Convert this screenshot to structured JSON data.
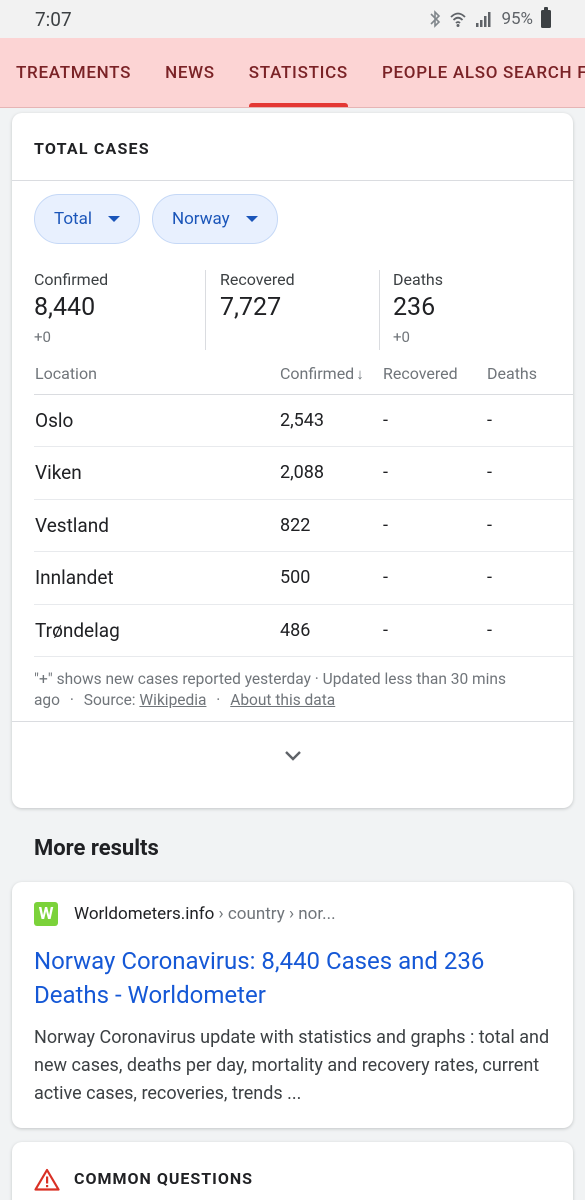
{
  "status": {
    "time": "7:07",
    "battery": "95%"
  },
  "tabs": [
    {
      "label": "TREATMENTS"
    },
    {
      "label": "NEWS"
    },
    {
      "label": "STATISTICS"
    },
    {
      "label": "PEOPLE ALSO SEARCH FOR"
    }
  ],
  "stats": {
    "title": "TOTAL CASES",
    "filter_scope": "Total",
    "filter_region": "Norway",
    "summary": {
      "confirmed_label": "Confirmed",
      "confirmed_value": "8,440",
      "confirmed_delta": "+0",
      "recovered_label": "Recovered",
      "recovered_value": "7,727",
      "deaths_label": "Deaths",
      "deaths_value": "236",
      "deaths_delta": "+0"
    },
    "table": {
      "headers": {
        "location": "Location",
        "confirmed": "Confirmed",
        "sort_arrow": "↓",
        "recovered": "Recovered",
        "deaths": "Deaths"
      },
      "rows": [
        {
          "location": "Oslo",
          "confirmed": "2,543",
          "recovered": "-",
          "deaths": "-"
        },
        {
          "location": "Viken",
          "confirmed": "2,088",
          "recovered": "-",
          "deaths": "-"
        },
        {
          "location": "Vestland",
          "confirmed": "822",
          "recovered": "-",
          "deaths": "-"
        },
        {
          "location": "Innlandet",
          "confirmed": "500",
          "recovered": "-",
          "deaths": "-"
        },
        {
          "location": "Trøndelag",
          "confirmed": "486",
          "recovered": "-",
          "deaths": "-"
        }
      ]
    },
    "footnote_text": "\"+\" shows new cases reported yesterday · Updated less than 30 mins ago",
    "source_label": "Source:",
    "source_link": "Wikipedia",
    "about_link": "About this data",
    "separator": "·"
  },
  "more_results_heading": "More results",
  "result": {
    "favicon_letter": "W",
    "site_name": "Worldometers.info",
    "site_path": " › country › nor...",
    "title": "Norway Coronavirus: 8,440 Cases and 236 Deaths - Worldometer",
    "snippet": "Norway Coronavirus update with statistics and graphs : total and new cases, deaths per day, mortality and recovery rates, current active cases, recoveries, trends ..."
  },
  "common_questions": {
    "title": "COMMON QUESTIONS"
  },
  "colors": {
    "tab_bg": "#fcd4d4",
    "tab_text": "#7a2226",
    "tab_indicator": "#e43834",
    "link": "#1558d6",
    "chip_bg": "#e8f0fe",
    "warning": "#d93025"
  }
}
